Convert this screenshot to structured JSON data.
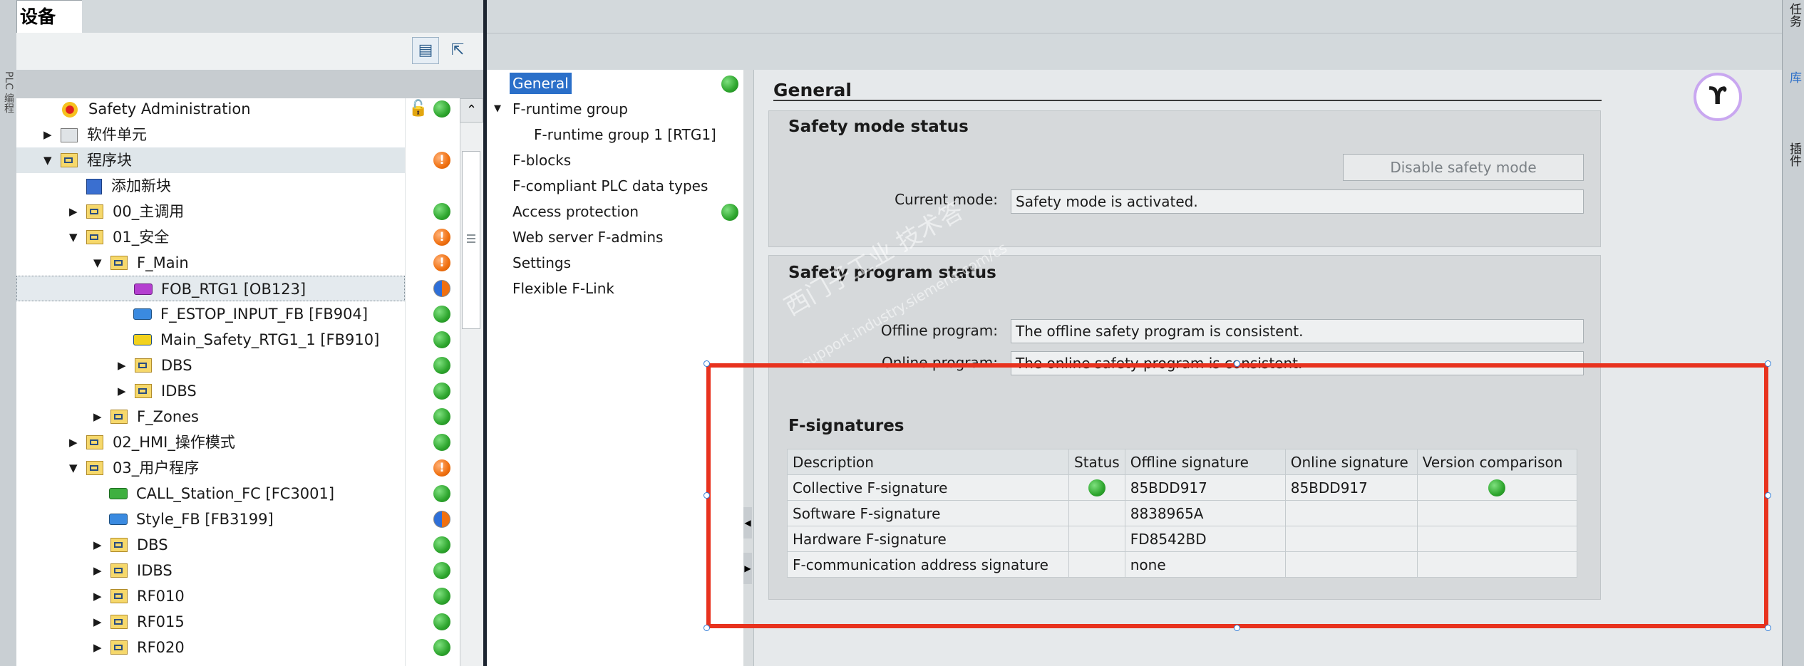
{
  "project_tree": {
    "tab_label": "设备",
    "left_strip_label": "PLC 编程",
    "rows": [
      {
        "label": "Safety Administration",
        "icon": "safety-admin-icon",
        "status": "green"
      },
      {
        "label": "软件单元",
        "icon": "software-unit-icon"
      },
      {
        "label": "程序块",
        "icon": "program-blocks-folder-icon",
        "status": "orange"
      },
      {
        "label": "添加新块",
        "icon": "add-block-icon"
      },
      {
        "label": "00_主调用",
        "icon": "folder-icon",
        "status": "green"
      },
      {
        "label": "01_安全",
        "icon": "folder-icon",
        "status": "orange"
      },
      {
        "label": "F_Main",
        "icon": "folder-icon",
        "status": "orange"
      },
      {
        "label": "FOB_RTG1 [OB123]",
        "icon": "ob-block-icon",
        "status": "half"
      },
      {
        "label": "F_ESTOP_INPUT_FB [FB904]",
        "icon": "fb-block-icon",
        "status": "green"
      },
      {
        "label": "Main_Safety_RTG1_1 [FB910]",
        "icon": "fb-block-icon",
        "status": "green"
      },
      {
        "label": "DBS",
        "icon": "folder-icon",
        "status": "green"
      },
      {
        "label": "IDBS",
        "icon": "folder-icon",
        "status": "green"
      },
      {
        "label": "F_Zones",
        "icon": "folder-icon",
        "status": "green"
      },
      {
        "label": "02_HMI_操作模式",
        "icon": "folder-icon",
        "status": "green"
      },
      {
        "label": "03_用户程序",
        "icon": "folder-icon",
        "status": "orange"
      },
      {
        "label": "CALL_Station_FC [FC3001]",
        "icon": "fc-block-icon",
        "status": "green"
      },
      {
        "label": "Style_FB [FB3199]",
        "icon": "fb-block-icon",
        "status": "half"
      },
      {
        "label": "DBS",
        "icon": "folder-icon",
        "status": "green"
      },
      {
        "label": "IDBS",
        "icon": "folder-icon",
        "status": "green"
      },
      {
        "label": "RF010",
        "icon": "folder-icon",
        "status": "green"
      },
      {
        "label": "RF015",
        "icon": "folder-icon",
        "status": "green"
      },
      {
        "label": "RF020",
        "icon": "folder-icon",
        "status": "green"
      }
    ]
  },
  "inspector_nav": {
    "items": [
      "General",
      "F-runtime group",
      "F-runtime group 1 [RTG1]",
      "F-blocks",
      "F-compliant PLC data types",
      "Access protection",
      "Web server F-admins",
      "Settings",
      "Flexible F-Link"
    ]
  },
  "general": {
    "title": "General",
    "safety_mode": {
      "title": "Safety mode status",
      "disable_button": "Disable safety mode",
      "current_mode_label": "Current mode:",
      "current_mode_value": "Safety mode is activated."
    },
    "safety_program": {
      "title": "Safety program status",
      "offline_label": "Offline program:",
      "offline_value": "The offline safety program is consistent.",
      "online_label": "Online program:",
      "online_value": "The online safety program is consistent."
    },
    "f_signatures": {
      "title": "F-signatures",
      "columns": [
        "Description",
        "Status",
        "Offline signature",
        "Online signature",
        "Version comparison"
      ],
      "rows": [
        {
          "description": "Collective F-signature",
          "status": "green",
          "offline": "85BDD917",
          "online": "85BDD917",
          "version": "green"
        },
        {
          "description": "Software F-signature",
          "status": "",
          "offline": "8838965A",
          "online": "",
          "version": ""
        },
        {
          "description": "Hardware F-signature",
          "status": "",
          "offline": "FD8542BD",
          "online": "",
          "version": ""
        },
        {
          "description": "F-communication address signature",
          "status": "",
          "offline": "none",
          "online": "",
          "version": ""
        }
      ]
    }
  },
  "watermark": {
    "line1": "西门子工业  技术答",
    "line2": "support.industry.siemens.com/cs"
  },
  "right_bar": {
    "tabs": [
      "任务",
      "库",
      "插件"
    ]
  },
  "colors": {
    "accent": "#2a6fc9",
    "status_green": "#2da52d",
    "status_orange": "#f07010",
    "highlight_box": "#e8321e"
  }
}
